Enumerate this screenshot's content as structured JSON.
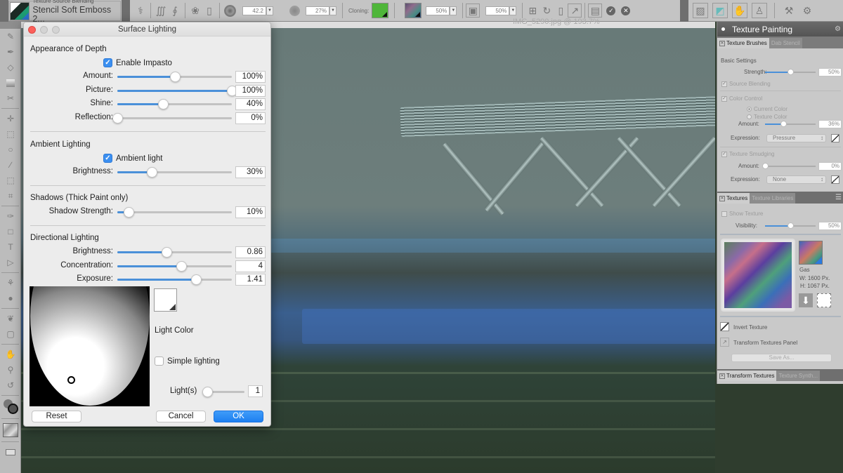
{
  "toolbar": {
    "brush_category": "Texture Source Blending",
    "brush_variant": "Stencil Soft Emboss 2...",
    "size_value": "42.2",
    "opacity_value": "27%",
    "cloning_label": "Cloning:",
    "texture_value": "50%",
    "layer_value": "50%",
    "icons": [
      "brush-tracking-icon",
      "stroke-icon",
      "stroke-alt-icon",
      "dab-icon",
      "stencil-icon",
      "size-circle-icon",
      "opacity-circle-icon",
      "clone-source-icon",
      "texture-swatch-icon",
      "layer-icon",
      "transform-icon",
      "rotate-icon",
      "mirror-icon",
      "resize-icon",
      "save-icon",
      "commit-icon",
      "cancel-icon",
      "panel-image-icon",
      "texture-painting-icon",
      "impasto-icon",
      "stamp-icon",
      "brush-settings-icon",
      "gear-icon"
    ]
  },
  "canvas": {
    "title": "IMG_5290.jpg @ 193.7%"
  },
  "dialog": {
    "title": "Surface Lighting",
    "appearance": {
      "title": "Appearance of Depth",
      "enable_impasto_label": "Enable Impasto",
      "enable_impasto_checked": true,
      "sliders": [
        {
          "label": "Amount:",
          "value": "100%",
          "fraction": 0.5
        },
        {
          "label": "Picture:",
          "value": "100%",
          "fraction": 1.0
        },
        {
          "label": "Shine:",
          "value": "40%",
          "fraction": 0.4
        },
        {
          "label": "Reflection:",
          "value": "0%",
          "fraction": 0.0
        }
      ]
    },
    "ambient": {
      "title": "Ambient Lighting",
      "ambient_light_label": "Ambient light",
      "ambient_light_checked": true,
      "sliders": [
        {
          "label": "Brightness:",
          "value": "30%",
          "fraction": 0.3
        }
      ]
    },
    "shadows": {
      "title": "Shadows (Thick Paint only)",
      "sliders": [
        {
          "label": "Shadow Strength:",
          "value": "10%",
          "fraction": 0.1
        }
      ]
    },
    "directional": {
      "title": "Directional Lighting",
      "sliders": [
        {
          "label": "Brightness:",
          "value": "0.86",
          "fraction": 0.43
        },
        {
          "label": "Concentration:",
          "value": "4",
          "fraction": 0.56
        },
        {
          "label": "Exposure:",
          "value": "1.41",
          "fraction": 0.69
        }
      ]
    },
    "light_color_label": "Light Color",
    "simple_lighting_label": "Simple lighting",
    "simple_lighting_checked": false,
    "lights_label": "Light(s)",
    "lights_value": "1",
    "lights_fraction": 0.0,
    "reset_label": "Reset",
    "cancel_label": "Cancel",
    "ok_label": "OK",
    "accent_color": "#3b8ff0"
  },
  "panel": {
    "title": "Texture Painting",
    "tabs_top": [
      {
        "label": "Texture Brushes",
        "active": true
      },
      {
        "label": "Dab Stencil",
        "active": false
      }
    ],
    "basic_settings_label": "Basic Settings",
    "strength_label": "Strength:",
    "strength_value": "50%",
    "strength_fraction": 0.5,
    "source_blending_label": "Source Blending",
    "color_control_label": "Color Control",
    "current_color_label": "Current Color",
    "texture_color_label": "Texture Color",
    "cc_amount_label": "Amount:",
    "cc_amount_value": "36%",
    "cc_amount_fraction": 0.36,
    "cc_expression_label": "Expression:",
    "cc_expression_value": "Pressure",
    "texture_smudging_label": "Texture Smudging",
    "ts_amount_label": "Amount:",
    "ts_amount_value": "0%",
    "ts_amount_fraction": 0.0,
    "ts_expression_label": "Expression:",
    "ts_expression_value": "None",
    "tabs_mid": [
      {
        "label": "Textures",
        "active": true
      },
      {
        "label": "Texture Libraries",
        "active": false
      }
    ],
    "show_texture_label": "Show Texture",
    "visibility_label": "Visibility:",
    "visibility_value": "50%",
    "visibility_fraction": 0.5,
    "texture_name": "Gas",
    "texture_width": "W:  1600 Px.",
    "texture_height": "H:  1067 Px.",
    "invert_texture_label": "Invert Texture",
    "transform_textures_label": "Transform Textures Panel",
    "save_as_label": "Save As...",
    "tabs_bottom": [
      {
        "label": "Transform Textures",
        "active": true
      },
      {
        "label": "Texture Synth...",
        "active": false
      }
    ]
  }
}
